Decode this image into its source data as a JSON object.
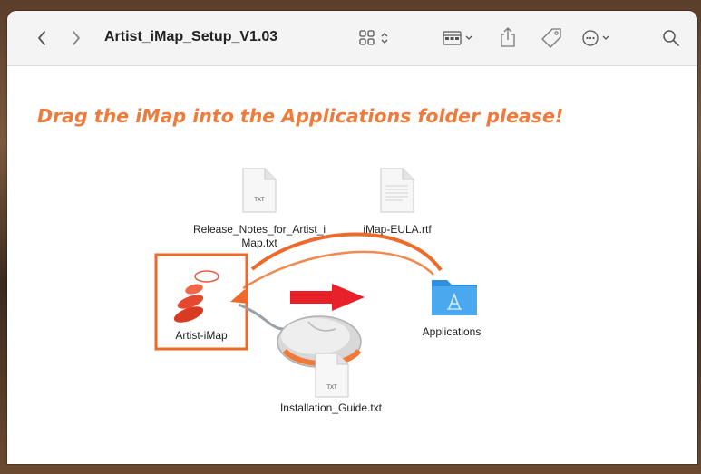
{
  "window": {
    "title": "Artist_iMap_Setup_V1.03"
  },
  "toolbar": {
    "back_icon": "chevron-left-icon",
    "forward_icon": "chevron-right-icon",
    "view_icon": "grid-view-icon",
    "group_icon": "group-by-icon",
    "share_icon": "share-icon",
    "tag_icon": "tag-icon",
    "more_icon": "ellipsis-circle-icon",
    "search_icon": "search-icon"
  },
  "content": {
    "headline": "Drag the iMap into the Applications folder please!",
    "files": [
      {
        "name": "Release_Notes_for_Artist_i",
        "name_line2": "Map.txt",
        "badge": "TXT",
        "icon": "text-document-icon"
      },
      {
        "name": "iMap-EULA.rtf",
        "icon": "rtf-document-icon"
      },
      {
        "name": "Artist-iMap",
        "icon": "artist-imap-app-icon"
      },
      {
        "name": "Applications",
        "icon": "applications-folder-icon"
      },
      {
        "name": "Installation_Guide.txt",
        "badge": "TXT",
        "icon": "text-document-icon"
      }
    ]
  },
  "colors": {
    "accent_orange": "#f07a3a",
    "arrow_red": "#e8202a",
    "folder_blue": "#3a9ee8"
  }
}
